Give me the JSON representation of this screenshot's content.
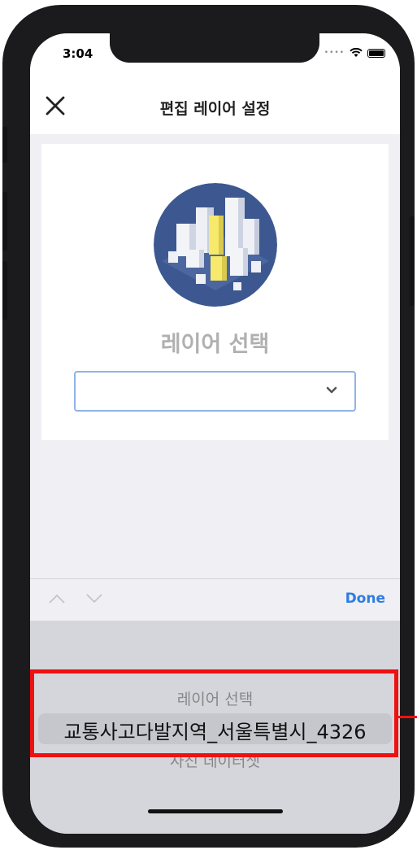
{
  "status_bar": {
    "time": "3:04",
    "icons": [
      "cellular-dots-icon",
      "wifi-icon",
      "battery-icon"
    ]
  },
  "nav": {
    "title": "편집 레이어 설정",
    "close_icon": "close-icon"
  },
  "card": {
    "title": "레이어 선택",
    "select_value": "",
    "select_icon": "chevron-down-icon",
    "illustration": "city-isometric-illustration"
  },
  "toolbar": {
    "prev_icon": "chevron-up-icon",
    "next_icon": "chevron-down-icon",
    "done_label": "Done"
  },
  "picker": {
    "options": [
      "레이어 선택",
      "교통사고다발지역_서울특별시_4326",
      "사진 데이터셋"
    ],
    "selected_index": 1
  },
  "colors": {
    "accent": "#2f7ce0",
    "highlight": "#ee1111",
    "select_border": "#8fb3e6"
  }
}
